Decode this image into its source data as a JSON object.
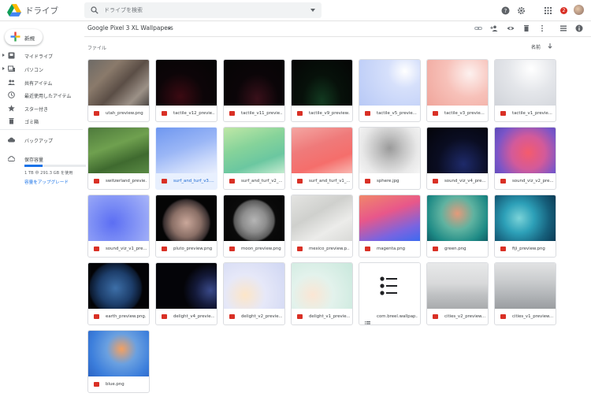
{
  "app": {
    "title": "ドライブ"
  },
  "search": {
    "placeholder": "ドライブを検索"
  },
  "header": {
    "notification_count": "2"
  },
  "sidebar": {
    "new_label": "新規",
    "items": [
      {
        "label": "マイドライブ",
        "icon": "my-drive-icon",
        "expandable": true
      },
      {
        "label": "パソコン",
        "icon": "computers-icon",
        "expandable": true
      },
      {
        "label": "共有アイテム",
        "icon": "shared-icon",
        "expandable": false
      },
      {
        "label": "最近使用したアイテム",
        "icon": "recent-icon",
        "expandable": false
      },
      {
        "label": "スター付き",
        "icon": "star-icon",
        "expandable": false
      },
      {
        "label": "ゴミ箱",
        "icon": "trash-icon",
        "expandable": false
      }
    ],
    "backup_label": "バックアップ",
    "storage": {
      "label": "保存容量",
      "used_fraction": 0.29,
      "text": "1 TB 中 291.3 GB を使用",
      "upgrade_label": "容量をアップグレード"
    }
  },
  "main": {
    "breadcrumb": "Google Pixel 3 XL Wallpapers",
    "section_label": "ファイル",
    "sort_label": "名前",
    "files": [
      {
        "name": "utah_preview.png",
        "thumb": "t-utah"
      },
      {
        "name": "tactile_v12_previe...",
        "thumb": "t-dark-red"
      },
      {
        "name": "tactile_v11_previe...",
        "thumb": "t-dark-red2"
      },
      {
        "name": "tactile_v9_preview...",
        "thumb": "t-dark-green"
      },
      {
        "name": "tactile_v5_previe...",
        "thumb": "t-blue-pale"
      },
      {
        "name": "tactile_v3_previe...",
        "thumb": "t-pink"
      },
      {
        "name": "tactile_v1_previe...",
        "thumb": "t-gray-pale"
      },
      {
        "name": "switzerland_previe...",
        "thumb": "t-switz"
      },
      {
        "name": "surf_and_turf_v3....",
        "thumb": "t-blue-wave",
        "selected": true
      },
      {
        "name": "surf_and_turf_v2_...",
        "thumb": "t-green-wave"
      },
      {
        "name": "surf_and_turf_v1_...",
        "thumb": "t-red-wave"
      },
      {
        "name": "sphere.jpg",
        "thumb": "t-sphere"
      },
      {
        "name": "sound_viz_v4_pre...",
        "thumb": "t-dark-blue"
      },
      {
        "name": "sound_viz_v2_pre...",
        "thumb": "t-purple-pink"
      },
      {
        "name": "sound_viz_v1_pre...",
        "thumb": "t-blue-glow"
      },
      {
        "name": "pluto_preview.png",
        "thumb": "t-pluto"
      },
      {
        "name": "moon_preview.png",
        "thumb": "t-moon"
      },
      {
        "name": "mexico_preview.p...",
        "thumb": "t-mexico"
      },
      {
        "name": "magenta.png",
        "thumb": "t-magenta"
      },
      {
        "name": "green.png",
        "thumb": "t-green-teal"
      },
      {
        "name": "fiji_preview.png",
        "thumb": "t-fiji"
      },
      {
        "name": "earth_preview.png...",
        "thumb": "t-earth"
      },
      {
        "name": "delight_v4_previe...",
        "thumb": "t-delight4"
      },
      {
        "name": "delight_v2_previe...",
        "thumb": "t-delight2"
      },
      {
        "name": "delight_v1_previe...",
        "thumb": "t-delight1"
      },
      {
        "name": "com.breel.wallpap...",
        "thumb": "t-white",
        "filetype": "list"
      },
      {
        "name": "cities_v2_preview...",
        "thumb": "t-cities2"
      },
      {
        "name": "cities_v1_preview...",
        "thumb": "t-cities1"
      },
      {
        "name": "blue.png",
        "thumb": "t-blue2"
      }
    ]
  }
}
